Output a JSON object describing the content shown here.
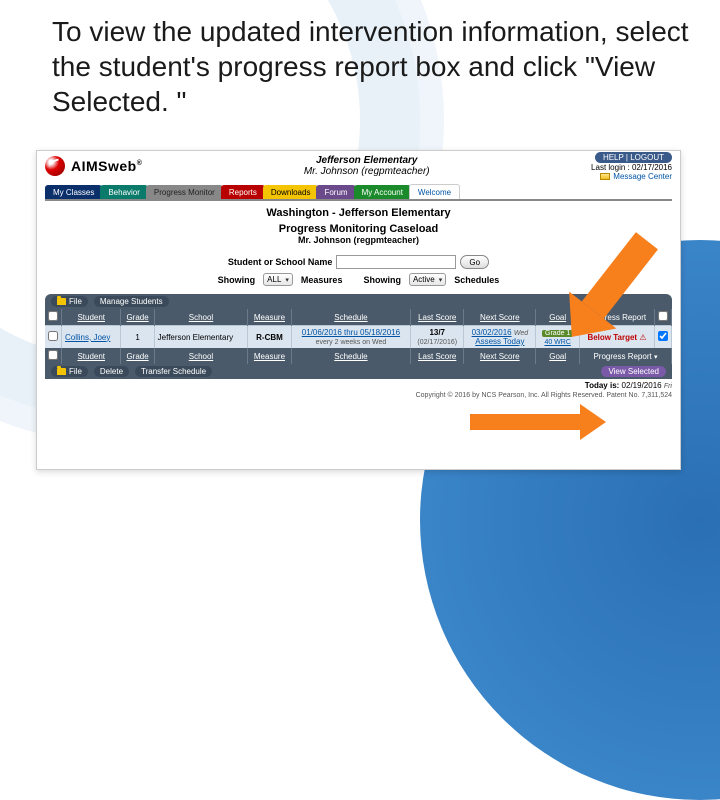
{
  "heading": "To view the updated intervention information, select the student's progress report box and click \"View Selected. \"",
  "header": {
    "brand": "AIMSweb",
    "regmark": "®",
    "school": "Jefferson Elementary",
    "user_line": "Mr. Johnson (regpmteacher)",
    "help_logout": "HELP  |  LOGOUT",
    "last_login": "Last login : 02/17/2016",
    "message_center": "Message Center"
  },
  "tabs": {
    "my_classes": "My Classes",
    "behavior": "Behavior",
    "progress_monitor": "Progress Monitor",
    "reports": "Reports",
    "downloads": "Downloads",
    "forum": "Forum",
    "my_account": "My Account",
    "welcome": "Welcome"
  },
  "panel": {
    "site": "Washington - Jefferson Elementary",
    "title": "Progress Monitoring Caseload",
    "sub": "Mr. Johnson (regpmteacher)"
  },
  "filters": {
    "name_label": "Student or School Name",
    "go": "Go",
    "showing1": "Showing",
    "sel1": "ALL",
    "measures": "Measures",
    "showing2": "Showing",
    "sel2": "Active",
    "schedules": "Schedules"
  },
  "toolbar": {
    "file": "File",
    "manage": "Manage Students"
  },
  "columns": {
    "student": "Student",
    "grade": "Grade",
    "school": "School",
    "measure": "Measure",
    "schedule": "Schedule",
    "last_score": "Last Score",
    "next_score": "Next Score",
    "goal": "Goal",
    "progress_report": "Progress Report"
  },
  "row": {
    "student": "Collins, Joey",
    "grade": "1",
    "school": "Jefferson Elementary",
    "measure": "R-CBM",
    "schedule_top": "01/06/2016 thru 05/18/2016",
    "schedule_bot": "every 2 weeks on Wed",
    "last_score_top": "13/7",
    "last_score_bot": "(02/17/2016)",
    "next_score_top": "03/02/2016",
    "next_score_note": "Wed",
    "next_score_action": "Assess Today",
    "goal_top": "Grade 1",
    "goal_bot": "40 WRC",
    "progress_status": "Below Target"
  },
  "bottom": {
    "file": "File",
    "delete": "Delete",
    "transfer": "Transfer Schedule",
    "view_selected": "View Selected"
  },
  "footer": {
    "today_label": "Today is:",
    "today_value": "02/19/2016",
    "today_dow": "Fri",
    "copyright": "Copyright © 2016 by NCS Pearson, Inc. All Rights Reserved. Patent No. 7,311,524"
  }
}
